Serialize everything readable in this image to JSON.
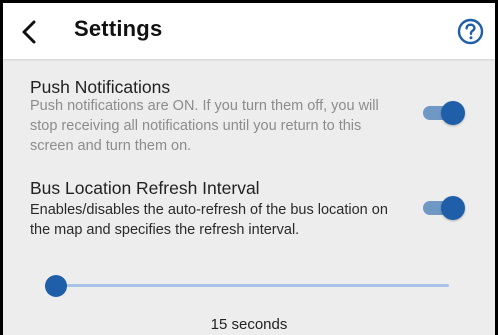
{
  "header": {
    "title": "Settings",
    "back_icon": "chevron-left-icon",
    "help_icon": "help-circle-icon"
  },
  "push_notifications": {
    "title": "Push Notifications",
    "description": "Push notifications are ON. If you turn them off, you will stop receiving all notifications until you return to this screen and turn them on.",
    "enabled": true
  },
  "bus_refresh": {
    "title": "Bus Location Refresh Interval",
    "description": "Enables/disables the auto-refresh of the bus location on the map and specifies the refresh interval.",
    "enabled": true,
    "slider_fraction": 0,
    "value_label": "15 seconds"
  },
  "colors": {
    "accent": "#1f5ea8",
    "toggle_track": "#6f98c5",
    "slider_rail": "#a9c3e6",
    "background": "#ededed",
    "help_icon": "#1f5ea8"
  }
}
